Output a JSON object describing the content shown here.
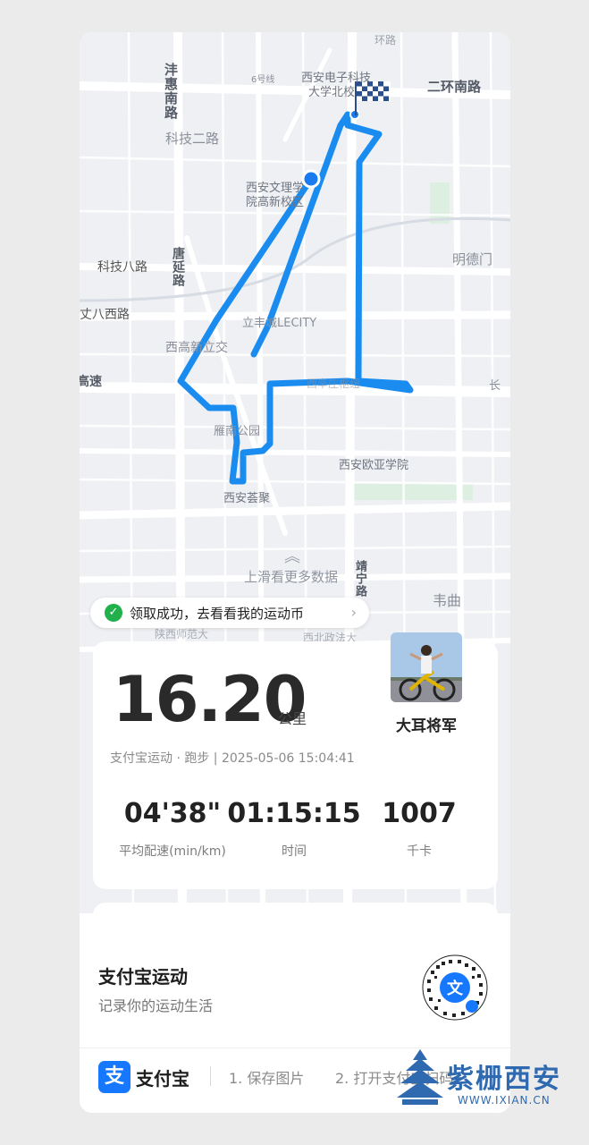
{
  "map": {
    "labels": [
      {
        "text": "沣惠南路",
        "vertical": true
      },
      {
        "text": "科技二路"
      },
      {
        "text": "西安电子科技"
      },
      {
        "text": "大学北校"
      },
      {
        "text": "二环南路",
        "bold": true
      },
      {
        "text": "西安文理学"
      },
      {
        "text": "院高新校区"
      },
      {
        "text": "明德门"
      },
      {
        "text": "科技八路"
      },
      {
        "text": "唐延路",
        "vertical": true
      },
      {
        "text": "丈八西路"
      },
      {
        "text": "立丰城LECITY"
      },
      {
        "text": "西高新立交"
      },
      {
        "text": "高速",
        "bold": true
      },
      {
        "text": "长"
      },
      {
        "text": "西辛庄枢纽"
      },
      {
        "text": "雁南公园"
      },
      {
        "text": "西安欧亚学院"
      },
      {
        "text": "西安荟聚"
      },
      {
        "text": "韦曲"
      },
      {
        "text": "靖宁路",
        "vertical": true
      },
      {
        "text": "陕西师范大"
      },
      {
        "text": "西北政法大"
      },
      {
        "text": "6号线"
      },
      {
        "text": "环路"
      }
    ],
    "route_color": "#1a8cf0",
    "hint_text": "上滑看更多数据"
  },
  "toast": {
    "text": "领取成功，去看看我的运动币"
  },
  "workout": {
    "distance": "16.20",
    "distance_unit": "公里",
    "username": "大耳将军",
    "meta": "支付宝运动 · 跑步 | 2025-05-06 15:04:41",
    "stats": [
      {
        "value": "04'38\"",
        "label": "平均配速(min/km)"
      },
      {
        "value": "01:15:15",
        "label": "时间"
      },
      {
        "value": "1007",
        "label": "千卡"
      }
    ]
  },
  "footer": {
    "title": "支付宝运动",
    "subtitle": "记录你的运动生活",
    "logo_glyph": "支",
    "logo_text": "支付宝",
    "step1": "1. 保存图片",
    "step2": "2. 打开支付宝扫码"
  },
  "watermark": {
    "text": "紫栅西安",
    "url": "WWW.IXIAN.CN"
  },
  "colors": {
    "accent_blue": "#1677ff",
    "route_blue": "#1a8cf0",
    "success_green": "#21b04b"
  }
}
